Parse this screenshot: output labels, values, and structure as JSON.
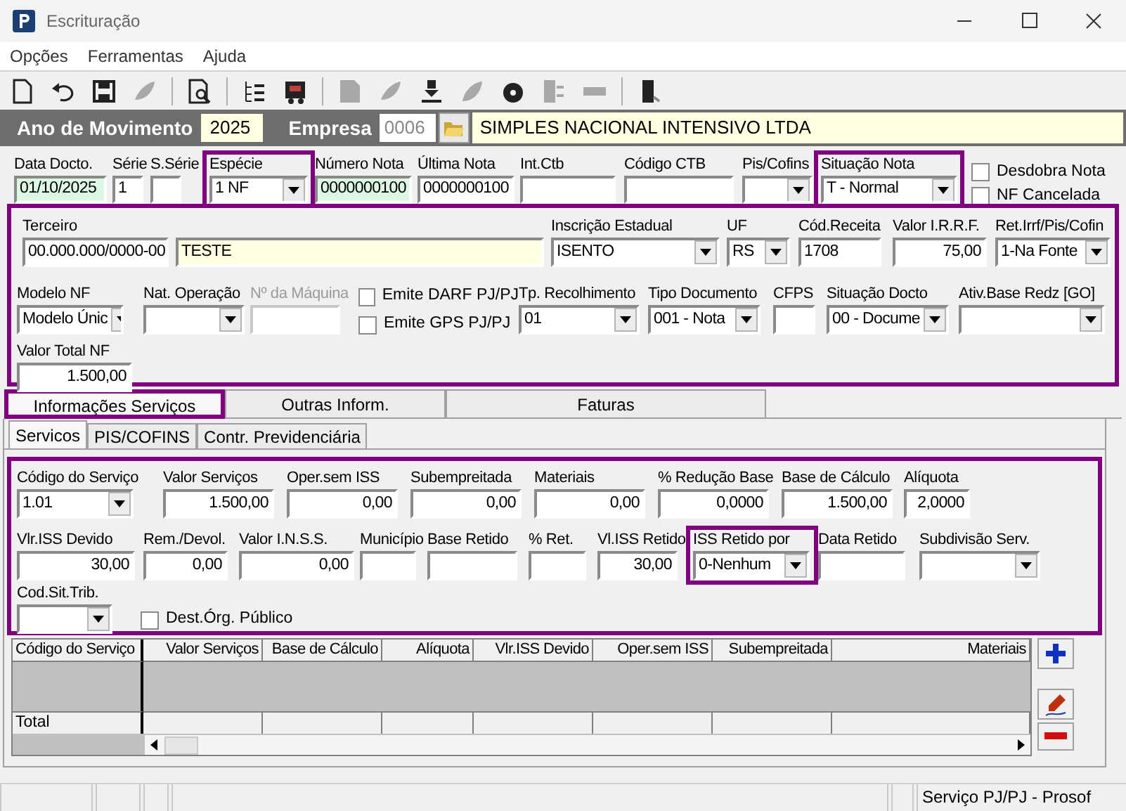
{
  "window": {
    "title": "Escrituração"
  },
  "menu": [
    "Opções",
    "Ferramentas",
    "Ajuda"
  ],
  "toolbar": [
    {
      "disabled": false
    },
    {
      "disabled": false
    },
    {
      "disabled": false
    },
    {
      "disabled": true
    },
    {
      "disabled": false
    },
    {
      "disabled": false
    },
    {
      "disabled": false
    },
    {
      "disabled": true
    },
    {
      "disabled": true
    },
    {
      "disabled": false
    },
    {
      "disabled": true
    },
    {
      "disabled": false
    },
    {
      "disabled": true
    },
    {
      "disabled": true
    },
    {
      "disabled": false
    }
  ],
  "header": {
    "year_label": "Ano de Movimento",
    "year": "2025",
    "company_label": "Empresa",
    "company_code": "0006",
    "company_name": "SIMPLES NACIONAL INTENSIVO LTDA"
  },
  "document": {
    "fields": [
      {
        "label": "Data Docto.",
        "value": "01/10/2025",
        "kind": "text",
        "marked": false
      },
      {
        "label": "Série",
        "value": "1",
        "kind": "text",
        "marked": false
      },
      {
        "label": "S.Série",
        "kind": "text",
        "marked": false
      },
      {
        "label": "Espécie",
        "value": "1 NF",
        "kind": "combo",
        "marked": true
      },
      {
        "label": "Número Nota",
        "value": "0000000100",
        "kind": "text",
        "marked": false
      },
      {
        "label": "Última Nota",
        "value": "0000000100",
        "kind": "text",
        "marked": false
      },
      {
        "label": "Int.Ctb",
        "kind": "text",
        "marked": false
      },
      {
        "label": "Código CTB",
        "kind": "text",
        "marked": false
      },
      {
        "label": "Pis/Cofins",
        "kind": "combo",
        "marked": false
      },
      {
        "label": "Situação Nota",
        "value": "T - Normal",
        "kind": "combo",
        "marked": true
      }
    ],
    "options": [
      {
        "label": "Desdobra Nota",
        "checked": false
      },
      {
        "label": "NF Cancelada",
        "checked": false
      }
    ]
  },
  "third_party": {
    "marked": true,
    "row_1": [
      {
        "label": "Terceiro",
        "value": "00.000.000/0000-00",
        "name": "TESTE",
        "kind": "pair"
      },
      {
        "label": "Inscrição Estadual",
        "value": "ISENTO",
        "kind": "combo"
      },
      {
        "label": "UF",
        "value": "RS",
        "kind": "combo"
      },
      {
        "label": "Cód.Receita",
        "value": "1708",
        "kind": "text"
      },
      {
        "label": "Valor I.R.R.F.",
        "value": "75,00",
        "kind": "text"
      },
      {
        "label": "Ret.Irrf/Pis/Cofin",
        "value": "1-Na Fonte",
        "kind": "combo"
      }
    ],
    "row_2": [
      {
        "label": "Modelo NF",
        "value": "Modelo Únic",
        "kind": "combo",
        "disabled": false
      },
      {
        "label": "Nat. Operação",
        "kind": "combo",
        "disabled": false
      },
      {
        "label": "Nº da Máquina",
        "kind": "text",
        "disabled": true
      },
      {
        "kind": "checks",
        "disabled": false,
        "items": [
          {
            "label": "Emite DARF PJ/PJ",
            "checked": false
          },
          {
            "label": "Emite GPS PJ/PJ",
            "checked": false
          }
        ]
      },
      {
        "label": "Tp. Recolhimento",
        "value": "01",
        "kind": "combo",
        "disabled": false
      },
      {
        "label": "Tipo Documento",
        "value": "001 - Nota",
        "kind": "combo",
        "disabled": false
      },
      {
        "label": "CFPS",
        "kind": "text",
        "disabled": false
      },
      {
        "label": "Situação Docto",
        "value": "00 - Docume",
        "kind": "combo",
        "disabled": false
      },
      {
        "label": "Ativ.Base Redz [GO]",
        "kind": "combo",
        "disabled": false
      }
    ],
    "row_3": [
      {
        "label": "Valor Total NF",
        "value": "1.500,00",
        "kind": "text"
      }
    ]
  },
  "tabs": [
    {
      "label": "Informações Serviços",
      "selected": true,
      "marked": true
    },
    {
      "label": "Outras Inform.",
      "selected": false,
      "marked": false
    },
    {
      "label": "Faturas",
      "selected": false,
      "marked": false
    }
  ],
  "subtabs": [
    {
      "label": "Servicos",
      "selected": true
    },
    {
      "label": "PIS/COFINS",
      "selected": false
    },
    {
      "label": "Contr. Previdenciária",
      "selected": false
    }
  ],
  "services": {
    "marked": true,
    "row_1": [
      {
        "label": "Código do Serviço",
        "value": "1.01",
        "kind": "combo"
      },
      {
        "label": "Valor Serviços",
        "value": "1.500,00",
        "kind": "text"
      },
      {
        "label": "Oper.sem ISS",
        "value": "0,00",
        "kind": "text"
      },
      {
        "label": "Subempreitada",
        "value": "0,00",
        "kind": "text"
      },
      {
        "label": "Materiais",
        "value": "0,00",
        "kind": "text"
      },
      {
        "label": "% Redução Base",
        "value": "0,0000",
        "kind": "text"
      },
      {
        "label": "Base de Cálculo",
        "value": "1.500,00",
        "kind": "text"
      },
      {
        "label": "Alíquota",
        "value": "2,0000",
        "kind": "text"
      }
    ],
    "row_2": [
      {
        "label": "Vlr.ISS Devido",
        "value": "30,00",
        "kind": "text",
        "marked": false
      },
      {
        "label": "Rem./Devol.",
        "value": "0,00",
        "kind": "text",
        "marked": false
      },
      {
        "label": "Valor I.N.S.S.",
        "value": "0,00",
        "kind": "text",
        "marked": false
      },
      {
        "label": "Município",
        "kind": "text",
        "marked": false
      },
      {
        "label": "Base Retido",
        "kind": "text",
        "marked": false
      },
      {
        "label": "% Ret.",
        "kind": "text",
        "marked": false
      },
      {
        "label": "Vl.ISS Retido",
        "value": "30,00",
        "kind": "text",
        "marked": false
      },
      {
        "label": "ISS Retido por",
        "value": "0-Nenhum",
        "kind": "combo",
        "marked": true
      },
      {
        "label": "Data Retido",
        "kind": "text",
        "marked": false
      },
      {
        "label": "Subdivisão Serv.",
        "kind": "combo",
        "marked": false
      }
    ],
    "row_3": [
      {
        "label": "Cod.Sit.Trib.",
        "kind": "combo"
      },
      {
        "kind": "checks",
        "items": [
          {
            "label": "Dest.Órg. Público",
            "checked": false
          }
        ]
      }
    ]
  },
  "grid": {
    "columns": [
      "Código do Serviço",
      "Valor Serviços",
      "Base de Cálculo",
      "Alíquota",
      "Vlr.ISS Devido",
      "Oper.sem ISS",
      "Subempreitada",
      "Materiais"
    ],
    "total_label": "Total"
  },
  "status_bar": {
    "text": "Serviço PJ/PJ - Prosof"
  }
}
